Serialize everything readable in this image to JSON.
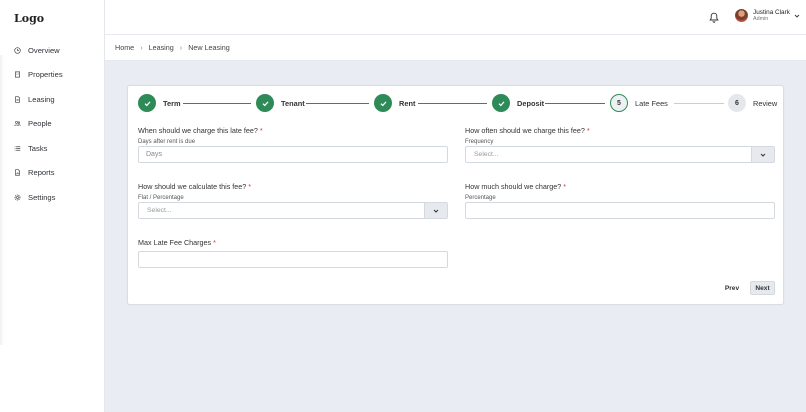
{
  "sidebar": {
    "logo": "Logo",
    "items": [
      {
        "label": "Overview",
        "icon": "clock-icon"
      },
      {
        "label": "Properties",
        "icon": "building-icon"
      },
      {
        "label": "Leasing",
        "icon": "document-icon"
      },
      {
        "label": "People",
        "icon": "people-icon"
      },
      {
        "label": "Tasks",
        "icon": "list-icon"
      },
      {
        "label": "Reports",
        "icon": "report-icon"
      },
      {
        "label": "Settings",
        "icon": "gear-icon"
      }
    ]
  },
  "header": {
    "user_name": "Justina Clark",
    "user_role": "Admin"
  },
  "breadcrumb": [
    "Home",
    "Leasing",
    "New Leasing"
  ],
  "stepper": {
    "steps": [
      {
        "label": "Term",
        "state": "done",
        "number": ""
      },
      {
        "label": "Tenant",
        "state": "done",
        "number": ""
      },
      {
        "label": "Rent",
        "state": "done",
        "number": ""
      },
      {
        "label": "Deposit",
        "state": "done",
        "number": ""
      },
      {
        "label": "Late Fees",
        "state": "active",
        "number": "5"
      },
      {
        "label": "Review",
        "state": "pending",
        "number": "6"
      }
    ]
  },
  "form": {
    "q1": {
      "label": "When should we charge this late fee?",
      "req": "*",
      "sub": "Days after rent is due",
      "value": "Days"
    },
    "q2": {
      "label": "How often should we charge this fee?",
      "req": "*",
      "sub": "Frequency",
      "placeholder": "Select..."
    },
    "q3": {
      "label": "How should we calculate this fee?",
      "req": "*",
      "sub": "Flat / Percentage",
      "placeholder": "Select..."
    },
    "q4": {
      "label": "How much should we charge?",
      "req": "*",
      "sub": "Percentage",
      "value": ""
    },
    "q5": {
      "label": "Max Late Fee Charges",
      "req": "*",
      "value": ""
    }
  },
  "buttons": {
    "prev": "Prev",
    "next": "Next"
  },
  "colors": {
    "accent": "#2e8b57",
    "background": "#e9edf3",
    "required": "#dd3333"
  }
}
